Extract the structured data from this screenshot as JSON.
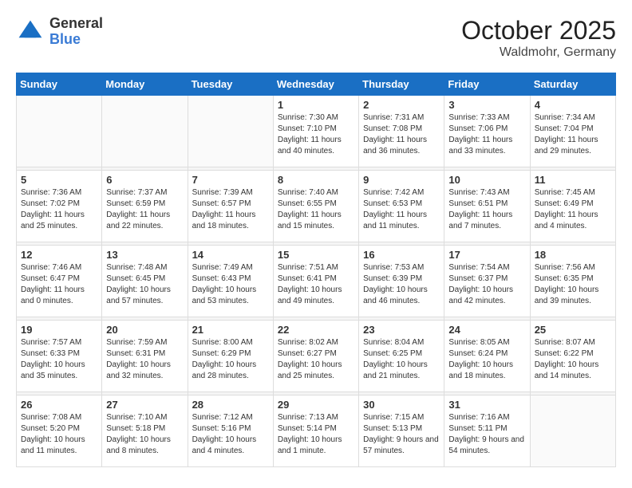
{
  "header": {
    "logo_general": "General",
    "logo_blue": "Blue",
    "title": "October 2025",
    "subtitle": "Waldmohr, Germany"
  },
  "weekdays": [
    "Sunday",
    "Monday",
    "Tuesday",
    "Wednesday",
    "Thursday",
    "Friday",
    "Saturday"
  ],
  "weeks": [
    [
      {
        "day": "",
        "info": ""
      },
      {
        "day": "",
        "info": ""
      },
      {
        "day": "",
        "info": ""
      },
      {
        "day": "1",
        "info": "Sunrise: 7:30 AM\nSunset: 7:10 PM\nDaylight: 11 hours\nand 40 minutes."
      },
      {
        "day": "2",
        "info": "Sunrise: 7:31 AM\nSunset: 7:08 PM\nDaylight: 11 hours\nand 36 minutes."
      },
      {
        "day": "3",
        "info": "Sunrise: 7:33 AM\nSunset: 7:06 PM\nDaylight: 11 hours\nand 33 minutes."
      },
      {
        "day": "4",
        "info": "Sunrise: 7:34 AM\nSunset: 7:04 PM\nDaylight: 11 hours\nand 29 minutes."
      }
    ],
    [
      {
        "day": "5",
        "info": "Sunrise: 7:36 AM\nSunset: 7:02 PM\nDaylight: 11 hours\nand 25 minutes."
      },
      {
        "day": "6",
        "info": "Sunrise: 7:37 AM\nSunset: 6:59 PM\nDaylight: 11 hours\nand 22 minutes."
      },
      {
        "day": "7",
        "info": "Sunrise: 7:39 AM\nSunset: 6:57 PM\nDaylight: 11 hours\nand 18 minutes."
      },
      {
        "day": "8",
        "info": "Sunrise: 7:40 AM\nSunset: 6:55 PM\nDaylight: 11 hours\nand 15 minutes."
      },
      {
        "day": "9",
        "info": "Sunrise: 7:42 AM\nSunset: 6:53 PM\nDaylight: 11 hours\nand 11 minutes."
      },
      {
        "day": "10",
        "info": "Sunrise: 7:43 AM\nSunset: 6:51 PM\nDaylight: 11 hours\nand 7 minutes."
      },
      {
        "day": "11",
        "info": "Sunrise: 7:45 AM\nSunset: 6:49 PM\nDaylight: 11 hours\nand 4 minutes."
      }
    ],
    [
      {
        "day": "12",
        "info": "Sunrise: 7:46 AM\nSunset: 6:47 PM\nDaylight: 11 hours\nand 0 minutes."
      },
      {
        "day": "13",
        "info": "Sunrise: 7:48 AM\nSunset: 6:45 PM\nDaylight: 10 hours\nand 57 minutes."
      },
      {
        "day": "14",
        "info": "Sunrise: 7:49 AM\nSunset: 6:43 PM\nDaylight: 10 hours\nand 53 minutes."
      },
      {
        "day": "15",
        "info": "Sunrise: 7:51 AM\nSunset: 6:41 PM\nDaylight: 10 hours\nand 49 minutes."
      },
      {
        "day": "16",
        "info": "Sunrise: 7:53 AM\nSunset: 6:39 PM\nDaylight: 10 hours\nand 46 minutes."
      },
      {
        "day": "17",
        "info": "Sunrise: 7:54 AM\nSunset: 6:37 PM\nDaylight: 10 hours\nand 42 minutes."
      },
      {
        "day": "18",
        "info": "Sunrise: 7:56 AM\nSunset: 6:35 PM\nDaylight: 10 hours\nand 39 minutes."
      }
    ],
    [
      {
        "day": "19",
        "info": "Sunrise: 7:57 AM\nSunset: 6:33 PM\nDaylight: 10 hours\nand 35 minutes."
      },
      {
        "day": "20",
        "info": "Sunrise: 7:59 AM\nSunset: 6:31 PM\nDaylight: 10 hours\nand 32 minutes."
      },
      {
        "day": "21",
        "info": "Sunrise: 8:00 AM\nSunset: 6:29 PM\nDaylight: 10 hours\nand 28 minutes."
      },
      {
        "day": "22",
        "info": "Sunrise: 8:02 AM\nSunset: 6:27 PM\nDaylight: 10 hours\nand 25 minutes."
      },
      {
        "day": "23",
        "info": "Sunrise: 8:04 AM\nSunset: 6:25 PM\nDaylight: 10 hours\nand 21 minutes."
      },
      {
        "day": "24",
        "info": "Sunrise: 8:05 AM\nSunset: 6:24 PM\nDaylight: 10 hours\nand 18 minutes."
      },
      {
        "day": "25",
        "info": "Sunrise: 8:07 AM\nSunset: 6:22 PM\nDaylight: 10 hours\nand 14 minutes."
      }
    ],
    [
      {
        "day": "26",
        "info": "Sunrise: 7:08 AM\nSunset: 5:20 PM\nDaylight: 10 hours\nand 11 minutes."
      },
      {
        "day": "27",
        "info": "Sunrise: 7:10 AM\nSunset: 5:18 PM\nDaylight: 10 hours\nand 8 minutes."
      },
      {
        "day": "28",
        "info": "Sunrise: 7:12 AM\nSunset: 5:16 PM\nDaylight: 10 hours\nand 4 minutes."
      },
      {
        "day": "29",
        "info": "Sunrise: 7:13 AM\nSunset: 5:14 PM\nDaylight: 10 hours\nand 1 minute."
      },
      {
        "day": "30",
        "info": "Sunrise: 7:15 AM\nSunset: 5:13 PM\nDaylight: 9 hours\nand 57 minutes."
      },
      {
        "day": "31",
        "info": "Sunrise: 7:16 AM\nSunset: 5:11 PM\nDaylight: 9 hours\nand 54 minutes."
      },
      {
        "day": "",
        "info": ""
      }
    ]
  ]
}
